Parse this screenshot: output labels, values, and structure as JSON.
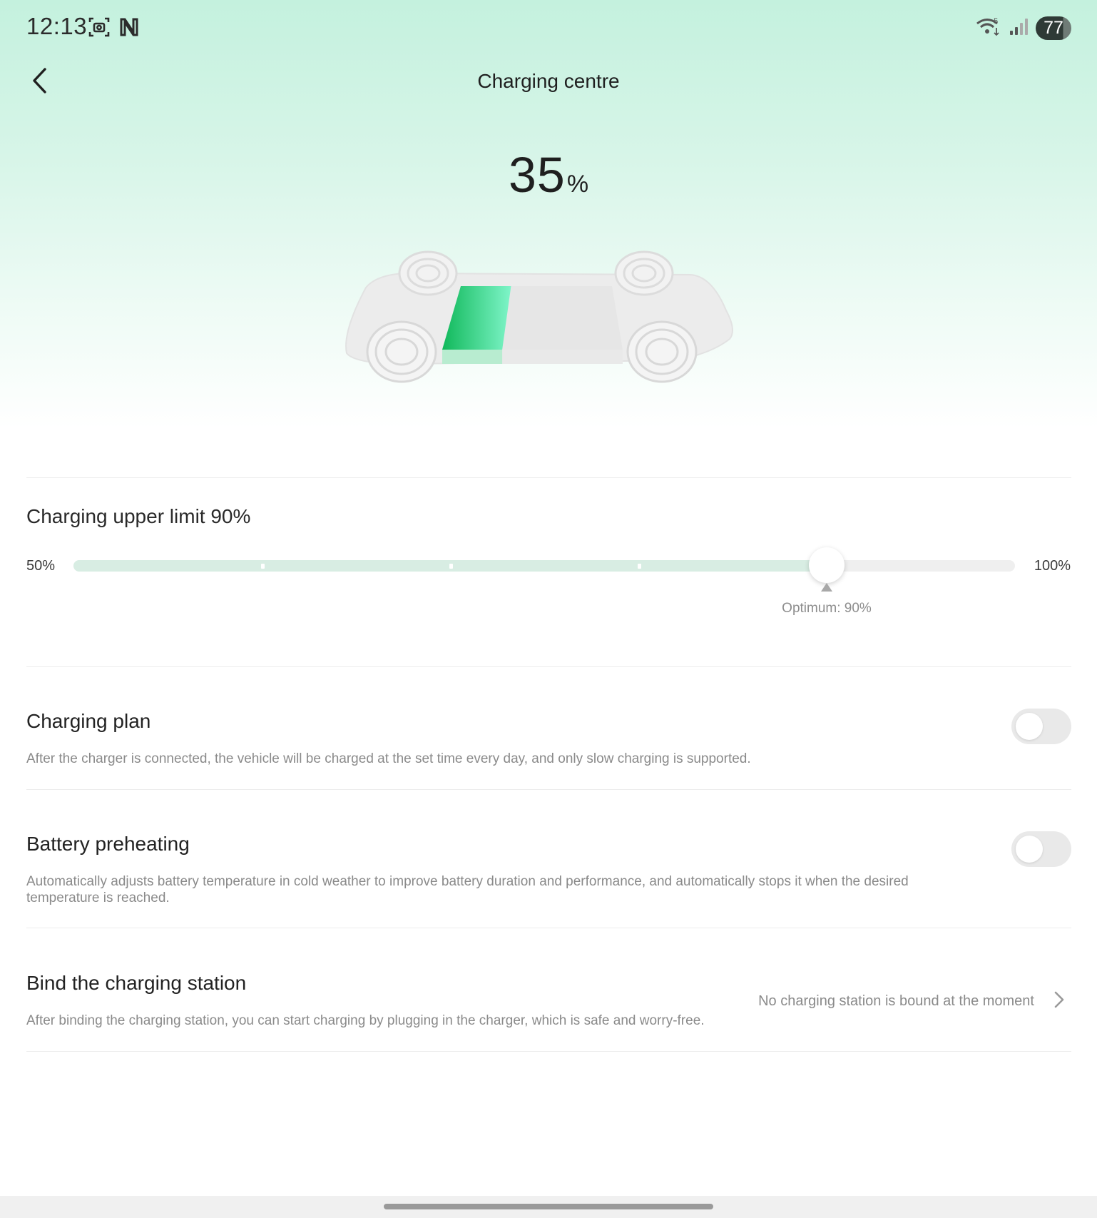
{
  "status_bar": {
    "time": "12:13",
    "left_icons": [
      "screenshot-icon",
      "nfc-icon"
    ],
    "right_icons": [
      "wifi-icon",
      "cellular-signal-icon"
    ],
    "wifi_badge": "5",
    "battery_level": "77"
  },
  "header": {
    "title": "Charging centre"
  },
  "battery": {
    "value": "35",
    "unit": "%",
    "level_fraction": 0.35,
    "colors": {
      "fill_dark": "#10b85a",
      "fill_light": "#7ff5c9",
      "empty": "#e6e6e6"
    }
  },
  "charging_limit": {
    "label": "Charging upper limit 90%",
    "min_label": "50%",
    "max_label": "100%",
    "min": 50,
    "max": 100,
    "value": 90,
    "optimum_value": 90,
    "optimum_label": "Optimum: 90%",
    "colors": {
      "fill": "#d8ede3",
      "track": "#efefef"
    }
  },
  "charging_plan": {
    "title": "Charging plan",
    "description": "After the charger is connected, the vehicle will be charged at the set time every day, and only slow charging is supported.",
    "enabled": false
  },
  "battery_preheating": {
    "title": "Battery preheating",
    "description": "Automatically adjusts battery temperature in cold weather to improve battery duration and performance, and automatically stops it when the desired temperature is reached.",
    "enabled": false
  },
  "charging_station": {
    "title": "Bind the charging station",
    "description": "After binding the charging station, you can start charging by plugging in the charger, which is safe and worry-free.",
    "status": "No charging station is bound at the moment"
  }
}
